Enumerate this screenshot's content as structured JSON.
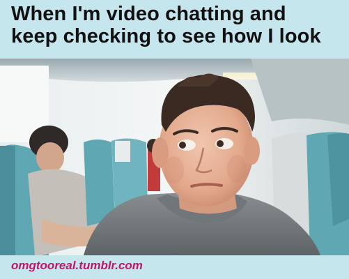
{
  "caption": {
    "line1": "When I'm video chatting and",
    "line2": "keep checking to see how I look"
  },
  "photo": {
    "scene": "airplane-cabin-selfie"
  },
  "footer": {
    "watermark": "omgtooreal.tumblr.com"
  },
  "colors": {
    "background": "#c6e6ee",
    "caption_text": "#111111",
    "watermark": "#c0156b",
    "seat_teal": "#5fa7b3"
  }
}
